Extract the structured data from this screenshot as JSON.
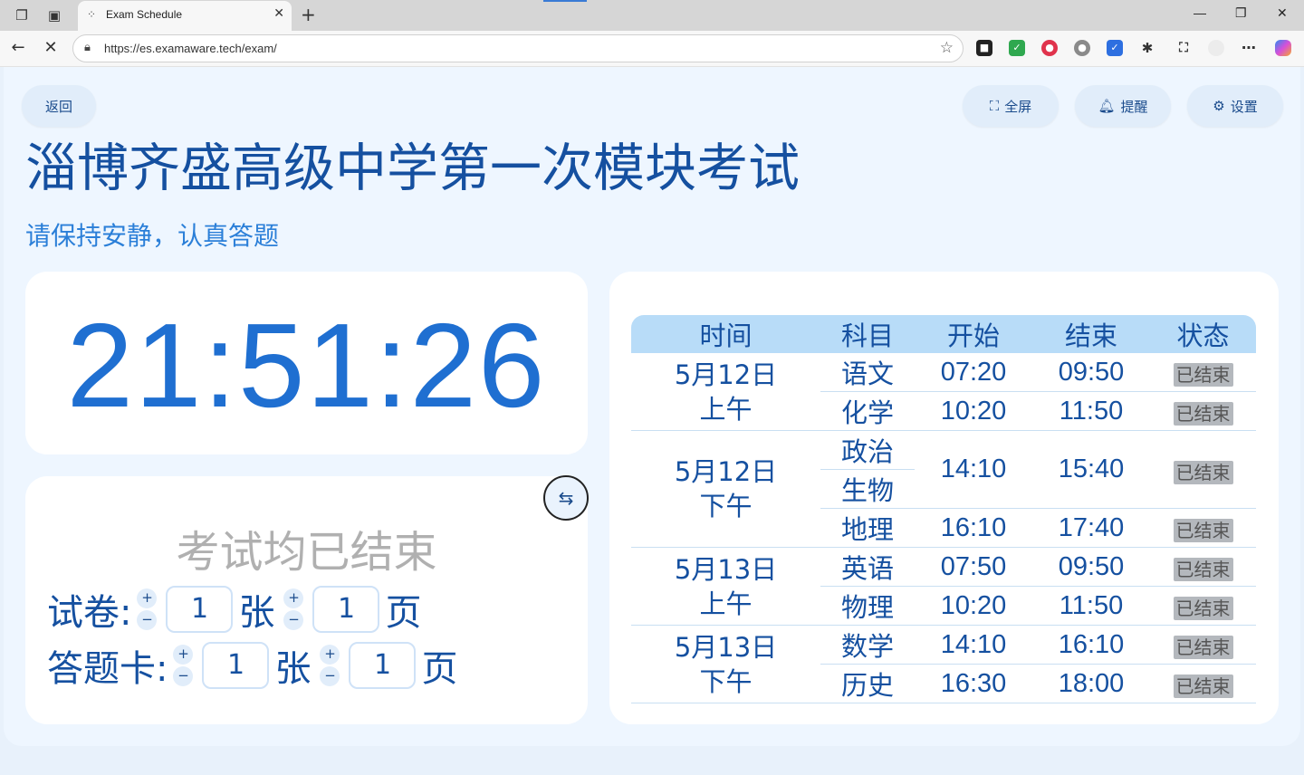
{
  "browser": {
    "tab_title": "Exam Schedule",
    "url": "https://es.examaware.tech/exam/"
  },
  "header": {
    "back_label": "返回",
    "fullscreen_label": "全屏",
    "remind_label": "提醒",
    "settings_label": "设置"
  },
  "exam": {
    "title": "淄博齐盛高级中学第一次模块考试",
    "subtitle": "请保持安静，认真答题"
  },
  "clock": {
    "time": "21:51:26"
  },
  "status_panel": {
    "message": "考试均已结束",
    "paper_label": "试卷:",
    "answer_card_label": "答题卡:",
    "sheet_unit": "张",
    "page_unit": "页",
    "paper_sheets": "1",
    "paper_pages": "1",
    "card_sheets": "1",
    "card_pages": "1",
    "plus": "+",
    "minus": "−"
  },
  "schedule": {
    "headers": [
      "时间",
      "科目",
      "开始",
      "结束",
      "状态"
    ],
    "groups": [
      {
        "date": "5月12日",
        "period": "上午"
      },
      {
        "date": "5月12日",
        "period": "下午"
      },
      {
        "date": "5月13日",
        "period": "上午"
      },
      {
        "date": "5月13日",
        "period": "下午"
      }
    ],
    "rows": [
      {
        "subject": "语文",
        "start": "07:20",
        "end": "09:50",
        "status": "已结束"
      },
      {
        "subject": "化学",
        "start": "10:20",
        "end": "11:50",
        "status": "已结束"
      },
      {
        "subject": "政治",
        "start": "14:10",
        "end": "15:40",
        "status": "已结束"
      },
      {
        "subject": "生物"
      },
      {
        "subject": "地理",
        "start": "16:10",
        "end": "17:40",
        "status": "已结束"
      },
      {
        "subject": "英语",
        "start": "07:50",
        "end": "09:50",
        "status": "已结束"
      },
      {
        "subject": "物理",
        "start": "10:20",
        "end": "11:50",
        "status": "已结束"
      },
      {
        "subject": "数学",
        "start": "14:10",
        "end": "16:10",
        "status": "已结束"
      },
      {
        "subject": "历史",
        "start": "16:30",
        "end": "18:00",
        "status": "已结束"
      }
    ]
  }
}
